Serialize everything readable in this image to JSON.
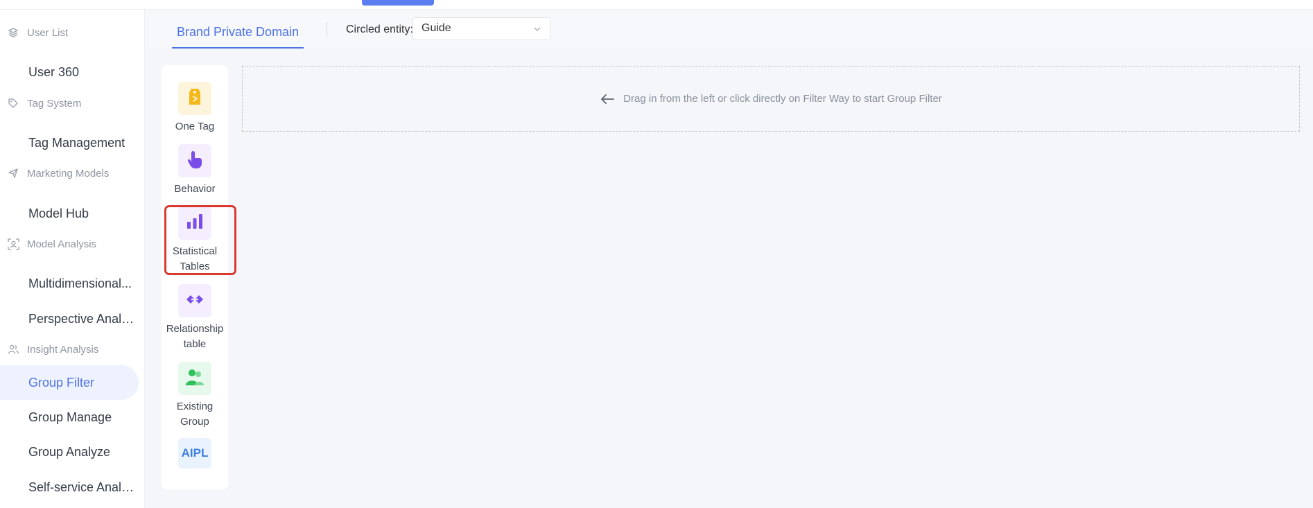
{
  "sidebar": {
    "sections": [
      {
        "label": "User List",
        "icon": "layers-icon",
        "items": [
          {
            "label": "User 360"
          }
        ]
      },
      {
        "label": "Tag System",
        "icon": "tag-icon",
        "items": [
          {
            "label": "Tag Management"
          }
        ]
      },
      {
        "label": "Marketing Models",
        "icon": "send-icon",
        "items": [
          {
            "label": "Model Hub"
          }
        ]
      },
      {
        "label": "Model Analysis",
        "icon": "scan-user-icon",
        "items": [
          {
            "label": "Multidimensional..."
          },
          {
            "label": "Perspective Analy..."
          }
        ]
      },
      {
        "label": "Insight Analysis",
        "icon": "group-icon",
        "items": [
          {
            "label": "Group Filter"
          },
          {
            "label": "Group Manage"
          },
          {
            "label": "Group Analyze"
          },
          {
            "label": "Self-service Analy..."
          }
        ]
      }
    ],
    "active_item": "Group Filter"
  },
  "header": {
    "tab_label": "Brand Private Domain",
    "circled_entity_label": "Circled entity:",
    "circled_entity_value": "Guide"
  },
  "filter_ways": [
    {
      "label": "One Tag",
      "icon": "tag-icon",
      "color": "#f5b81c"
    },
    {
      "label": "Behavior",
      "icon": "pointer-hand-icon",
      "color": "#7a4de8"
    },
    {
      "label": "Statistical Tables",
      "icon": "bar-chart-icon",
      "color": "#7a4de8",
      "highlighted": true
    },
    {
      "label": "Relationship table",
      "icon": "link-icon",
      "color": "#7a4de8"
    },
    {
      "label": "Existing Group",
      "icon": "users-icon",
      "color": "#2fbf5b"
    },
    {
      "label": "AIPL",
      "icon": "aipl-text-icon",
      "color": "#3b7de0"
    }
  ],
  "dropzone": {
    "text": "Drag in from the left or click directly on Filter Way to start Group Filter",
    "icon": "arrow-left-icon"
  },
  "colors": {
    "accent": "#4d72e8",
    "highlight_box": "#d93a2f"
  }
}
